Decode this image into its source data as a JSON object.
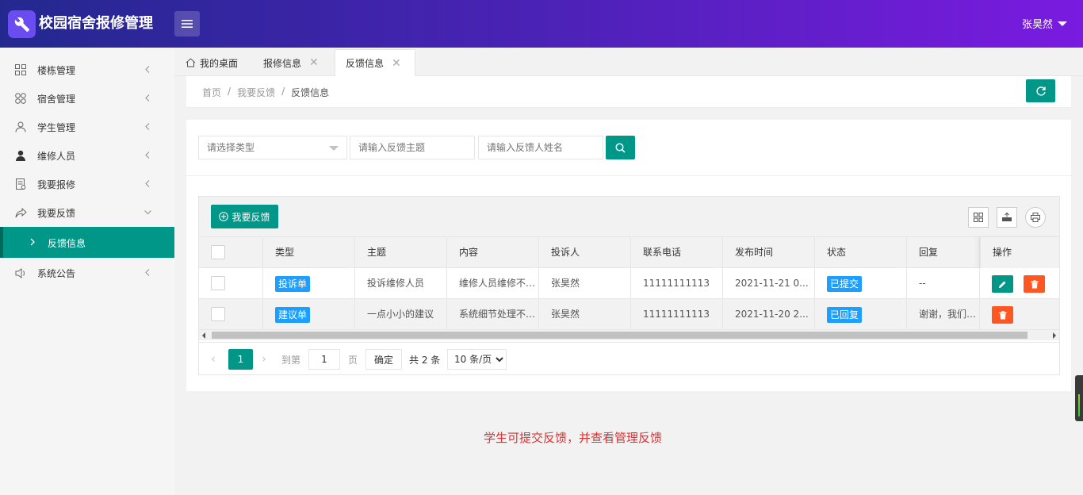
{
  "header": {
    "app_title": "校园宿舍报修管理",
    "user_name": "张昊然"
  },
  "sidebar": {
    "items": [
      {
        "label": "楼栋管理",
        "icon": "grid-icon"
      },
      {
        "label": "宿舍管理",
        "icon": "flower-icon"
      },
      {
        "label": "学生管理",
        "icon": "user-outline-icon"
      },
      {
        "label": "维修人员",
        "icon": "user-filled-icon"
      },
      {
        "label": "我要报修",
        "icon": "form-icon"
      },
      {
        "label": "我要反馈",
        "icon": "share-icon"
      },
      {
        "label": "系统公告",
        "icon": "speaker-icon"
      }
    ],
    "sub_item": {
      "label": "反馈信息"
    }
  },
  "tabs": [
    {
      "label": "我的桌面",
      "closable": false
    },
    {
      "label": "报修信息",
      "closable": true
    },
    {
      "label": "反馈信息",
      "closable": true,
      "active": true
    }
  ],
  "breadcrumb": {
    "items": [
      "首页",
      "我要反馈",
      "反馈信息"
    ],
    "separator": "/"
  },
  "filters": {
    "type_placeholder": "请选择类型",
    "subject_placeholder": "请输入反馈主题",
    "name_placeholder": "请输入反馈人姓名"
  },
  "toolbar": {
    "add_label": "我要反馈"
  },
  "table": {
    "columns": [
      "类型",
      "主题",
      "内容",
      "投诉人",
      "联系电话",
      "发布时间",
      "状态",
      "回复",
      "操作"
    ],
    "rows": [
      {
        "type": "投诉单",
        "subject": "投诉维修人员",
        "content": "维修人员维修不及时",
        "complainant": "张昊然",
        "phone": "11111111113",
        "time": "2021-11-21 0...",
        "status": "已提交",
        "reply": "--"
      },
      {
        "type": "建议单",
        "subject": "一点小小的建议",
        "content": "系统细节处理不够好",
        "complainant": "张昊然",
        "phone": "11111111113",
        "time": "2021-11-20 2...",
        "status": "已回复",
        "reply": "谢谢，我们将..."
      }
    ]
  },
  "pager": {
    "current_page": "1",
    "goto_label": "到第",
    "page_unit": "页",
    "goto_value": "1",
    "confirm_label": "确定",
    "total_label": "共 2 条",
    "page_size": "10 条/页"
  },
  "note": "学生可提交反馈，并查看管理反馈",
  "colors": {
    "primary": "#009688",
    "danger": "#ff5722",
    "badge": "#1e9fff",
    "header_start": "#23288f",
    "header_end": "#7a1be0",
    "note": "#e03030"
  }
}
